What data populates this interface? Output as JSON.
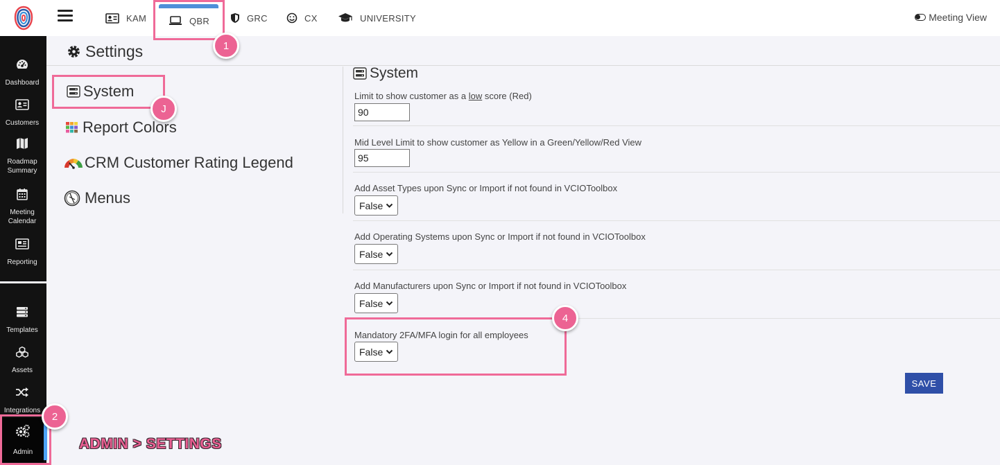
{
  "sidebar": {
    "items": [
      {
        "label": "Dashboard",
        "icon": "gauge-icon"
      },
      {
        "label": "Customers",
        "icon": "id-card-icon"
      },
      {
        "label": "Roadmap Summary",
        "icon": "map-icon"
      },
      {
        "label": "Meeting Calendar",
        "icon": "calendar-icon"
      },
      {
        "label": "Reporting",
        "icon": "newspaper-icon"
      },
      {
        "label": "Templates",
        "icon": "server-icon"
      },
      {
        "label": "Assets",
        "icon": "cubes-icon"
      },
      {
        "label": "Integrations",
        "icon": "shuffle-icon"
      },
      {
        "label": "Admin",
        "icon": "cogs-icon"
      }
    ]
  },
  "topnav": {
    "tabs": [
      {
        "label": "KAM",
        "icon": "id-card-icon"
      },
      {
        "label": "QBR",
        "icon": "laptop-icon"
      },
      {
        "label": "GRC",
        "icon": "shield-icon"
      },
      {
        "label": "CX",
        "icon": "smile-icon"
      },
      {
        "label": "UNIVERSITY",
        "icon": "graduation-cap-icon"
      }
    ],
    "meeting_view": "Meeting View"
  },
  "page": {
    "title": "Settings"
  },
  "settings_menu": {
    "items": [
      {
        "label": "System",
        "icon": "system-icon"
      },
      {
        "label": "Report Colors",
        "icon": "color-grid-icon"
      },
      {
        "label": "CRM Customer Rating Legend",
        "icon": "rating-gauge-icon"
      },
      {
        "label": "Menus",
        "icon": "compass-icon"
      }
    ]
  },
  "system": {
    "title": "System",
    "low_label_pre": "Limit to show customer as a ",
    "low_label_u": "low",
    "low_label_post": " score (Red)",
    "low_value": "90",
    "mid_label": "Mid Level Limit to show customer as Yellow in a Green/Yellow/Red View",
    "mid_value": "95",
    "asset_types_label": "Add Asset Types upon Sync or Import if not found in VCIOToolbox",
    "asset_types_value": "False",
    "os_label": "Add Operating Systems upon Sync or Import if not found in VCIOToolbox",
    "os_value": "False",
    "manufacturers_label": "Add Manufacturers upon Sync or Import if not found in VCIOToolbox",
    "manufacturers_value": "False",
    "mfa_label": "Mandatory 2FA/MFA login for all employees",
    "mfa_value": "False",
    "save_label": "SAVE"
  },
  "annotations": {
    "badges": [
      "1",
      "2",
      "J",
      "4"
    ],
    "caption": "ADMIN > SETTINGS"
  },
  "colors": {
    "highlight": "#ef6a98",
    "save_button": "#2f4fa8",
    "active_tab": "#4e8fd9",
    "admin_indicator": "#4da3f7"
  }
}
